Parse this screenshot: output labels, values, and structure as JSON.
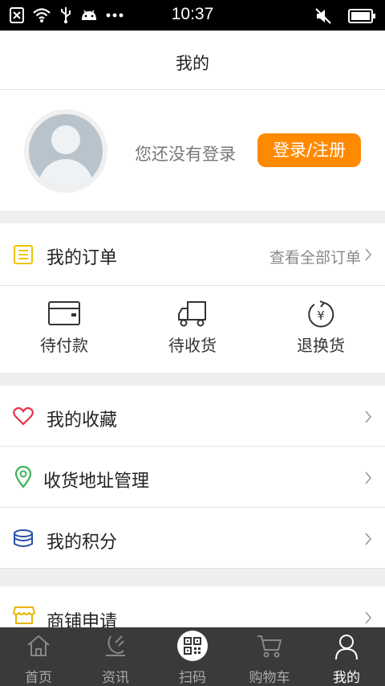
{
  "status_bar": {
    "time": "10:37"
  },
  "header": {
    "title": "我的"
  },
  "profile": {
    "not_logged_text": "您还没有登录",
    "login_button": "登录/注册"
  },
  "orders": {
    "title": "我的订单",
    "view_all": "查看全部订单",
    "statuses": [
      {
        "label": "待付款",
        "icon": "wallet-icon"
      },
      {
        "label": "待收货",
        "icon": "truck-icon"
      },
      {
        "label": "退换货",
        "icon": "refund-icon"
      }
    ]
  },
  "menu": [
    {
      "label": "我的收藏",
      "icon": "heart-icon",
      "color": "#e8334a"
    },
    {
      "label": "收货地址管理",
      "icon": "location-pin-icon",
      "color": "#3ab35a"
    },
    {
      "label": "我的积分",
      "icon": "coins-icon",
      "color": "#2a4fa8"
    }
  ],
  "menu2": [
    {
      "label": "商铺申请",
      "icon": "shop-icon",
      "color": "#e8b400"
    }
  ],
  "tabbar": [
    {
      "label": "首页",
      "icon": "home-icon"
    },
    {
      "label": "资讯",
      "icon": "news-icon"
    },
    {
      "label": "扫码",
      "icon": "qr-scan-icon"
    },
    {
      "label": "购物车",
      "icon": "cart-icon"
    },
    {
      "label": "我的",
      "icon": "user-icon",
      "active": true
    }
  ],
  "colors": {
    "accent": "#ff8a00",
    "tabbar_bg": "#3a3a3a",
    "order_icon": "#e8c600"
  }
}
